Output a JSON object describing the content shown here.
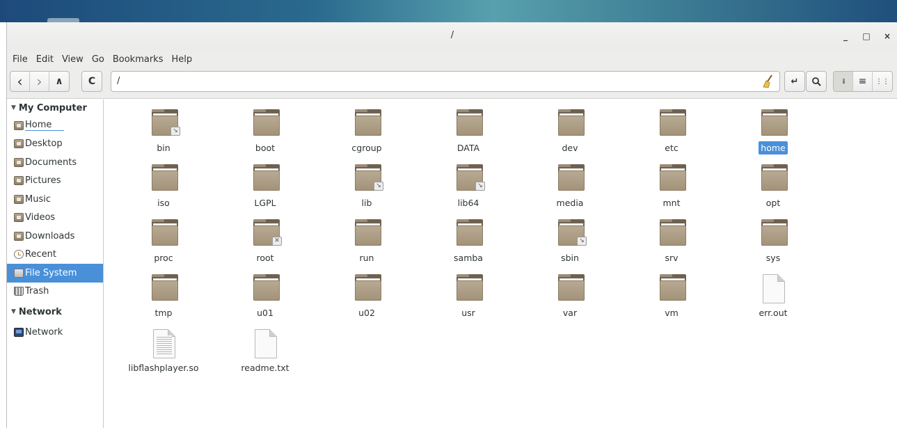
{
  "window": {
    "title": "/"
  },
  "window_controls": {
    "minimize": "_",
    "maximize": "□",
    "close": "×"
  },
  "menu": [
    "File",
    "Edit",
    "View",
    "Go",
    "Bookmarks",
    "Help"
  ],
  "toolbar": {
    "back_icon": "‹",
    "forward_icon": "›",
    "up_icon": "∧",
    "reload_icon": "C",
    "location": "/",
    "toggle_icon": "↵",
    "search_icon": "⚲",
    "icon_view_icon": "⁞⁞",
    "list_view_icon": "≡",
    "compact_view_icon": "⋮⋮"
  },
  "sidebar": {
    "my_computer": {
      "header": "My Computer",
      "items": [
        {
          "label": "Home",
          "icon": "folder-home-icon"
        },
        {
          "label": "Desktop",
          "icon": "folder-desktop-icon"
        },
        {
          "label": "Documents",
          "icon": "folder-documents-icon"
        },
        {
          "label": "Pictures",
          "icon": "folder-pictures-icon"
        },
        {
          "label": "Music",
          "icon": "folder-music-icon"
        },
        {
          "label": "Videos",
          "icon": "folder-videos-icon"
        },
        {
          "label": "Downloads",
          "icon": "folder-downloads-icon"
        },
        {
          "label": "Recent",
          "icon": "recent-icon"
        },
        {
          "label": "File System",
          "icon": "drive-icon"
        },
        {
          "label": "Trash",
          "icon": "trash-icon"
        }
      ]
    },
    "network": {
      "header": "Network",
      "items": [
        {
          "label": "Network",
          "icon": "network-icon"
        }
      ]
    }
  },
  "files": [
    {
      "name": "bin",
      "type": "folder",
      "emblem": "↘"
    },
    {
      "name": "boot",
      "type": "folder"
    },
    {
      "name": "cgroup",
      "type": "folder"
    },
    {
      "name": "DATA",
      "type": "folder"
    },
    {
      "name": "dev",
      "type": "folder"
    },
    {
      "name": "etc",
      "type": "folder"
    },
    {
      "name": "home",
      "type": "folder",
      "selected": true
    },
    {
      "name": "iso",
      "type": "folder"
    },
    {
      "name": "LGPL",
      "type": "folder"
    },
    {
      "name": "lib",
      "type": "folder",
      "emblem": "↘"
    },
    {
      "name": "lib64",
      "type": "folder",
      "emblem": "↘"
    },
    {
      "name": "media",
      "type": "folder"
    },
    {
      "name": "mnt",
      "type": "folder"
    },
    {
      "name": "opt",
      "type": "folder"
    },
    {
      "name": "proc",
      "type": "folder"
    },
    {
      "name": "root",
      "type": "folder",
      "emblem": "✕"
    },
    {
      "name": "run",
      "type": "folder"
    },
    {
      "name": "samba",
      "type": "folder"
    },
    {
      "name": "sbin",
      "type": "folder",
      "emblem": "↘"
    },
    {
      "name": "srv",
      "type": "folder"
    },
    {
      "name": "sys",
      "type": "folder"
    },
    {
      "name": "tmp",
      "type": "folder"
    },
    {
      "name": "u01",
      "type": "folder"
    },
    {
      "name": "u02",
      "type": "folder"
    },
    {
      "name": "usr",
      "type": "folder"
    },
    {
      "name": "var",
      "type": "folder"
    },
    {
      "name": "vm",
      "type": "folder"
    },
    {
      "name": "err.out",
      "type": "file"
    },
    {
      "name": "libflashplayer.so",
      "type": "file-lines"
    },
    {
      "name": "readme.txt",
      "type": "file"
    }
  ]
}
